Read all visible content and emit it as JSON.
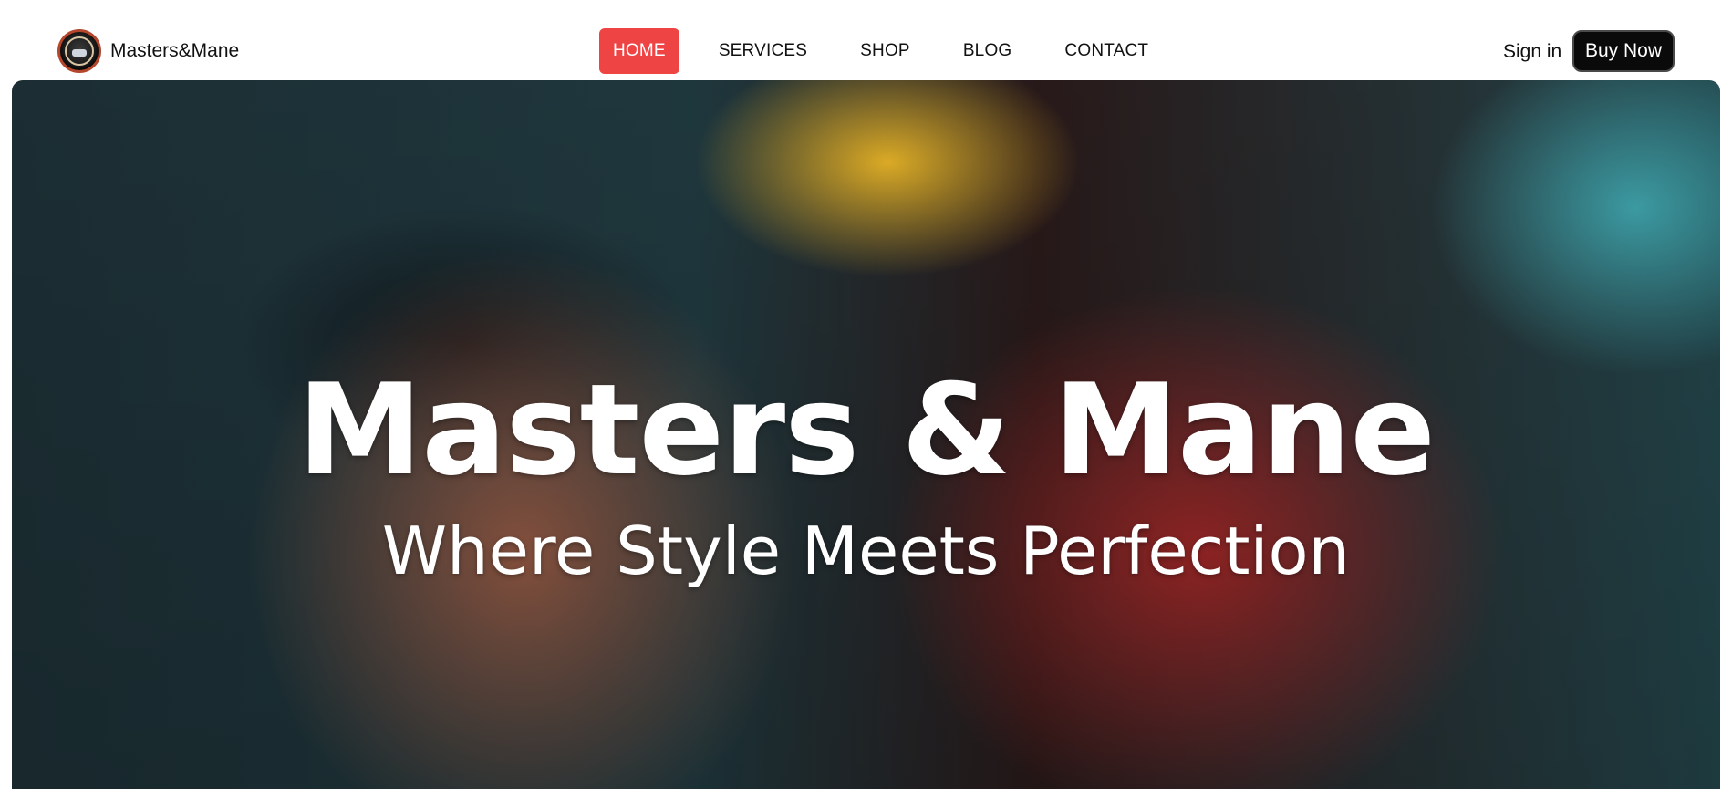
{
  "brand": {
    "name": "Masters&Mane",
    "logo_icon": "barber-logo-icon"
  },
  "nav": {
    "items": [
      {
        "label": "HOME",
        "active": true
      },
      {
        "label": "SERVICES",
        "active": false
      },
      {
        "label": "SHOP",
        "active": false
      },
      {
        "label": "BLOG",
        "active": false
      },
      {
        "label": "CONTACT",
        "active": false
      }
    ]
  },
  "auth": {
    "sign_in": "Sign in",
    "buy_now": "Buy Now"
  },
  "hero": {
    "title": "Masters & Mane",
    "subtitle": "Where Style Meets Perfection",
    "image_description_icon": "barber-cutting-hair-photo"
  },
  "colors": {
    "accent": "#ef4444",
    "button_dark": "#0a0a0a"
  }
}
